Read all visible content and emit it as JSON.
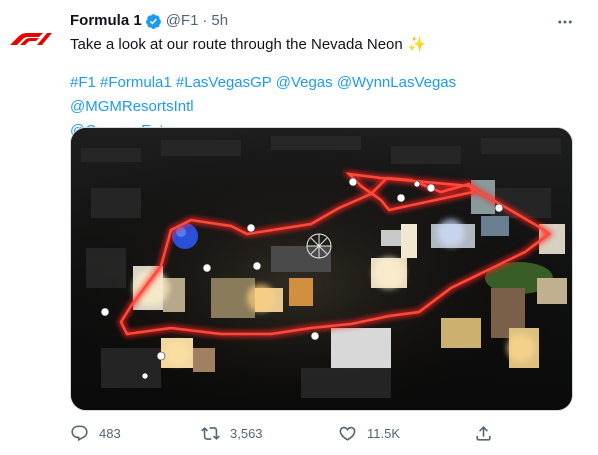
{
  "account": {
    "name": "Formula 1",
    "handle": "@F1",
    "separator": "·",
    "time": "5h",
    "logo_text": "F1"
  },
  "tweet": {
    "text": "Take a look at our route through the Nevada Neon",
    "emoji": "✨",
    "tags_line1": [
      "#F1",
      "#Formula1",
      "#LasVegasGP",
      "@Vegas",
      "@WynnLasVegas",
      "@MGMResortsIntl"
    ],
    "tags_line2": [
      "@CaesarsEnt"
    ]
  },
  "actions": {
    "replies": "483",
    "retweets": "3,563",
    "likes": "11.5K"
  },
  "colors": {
    "brand_red": "#e10600",
    "link_blue": "#1d9bf0",
    "muted": "#536471",
    "verified": "#1d9bf0"
  },
  "icons": {
    "avatar": "f1-logo",
    "verified": "verified-badge-icon",
    "more": "more-dots-icon",
    "reply": "reply-icon",
    "retweet": "retweet-icon",
    "like": "heart-icon",
    "share": "share-icon"
  }
}
